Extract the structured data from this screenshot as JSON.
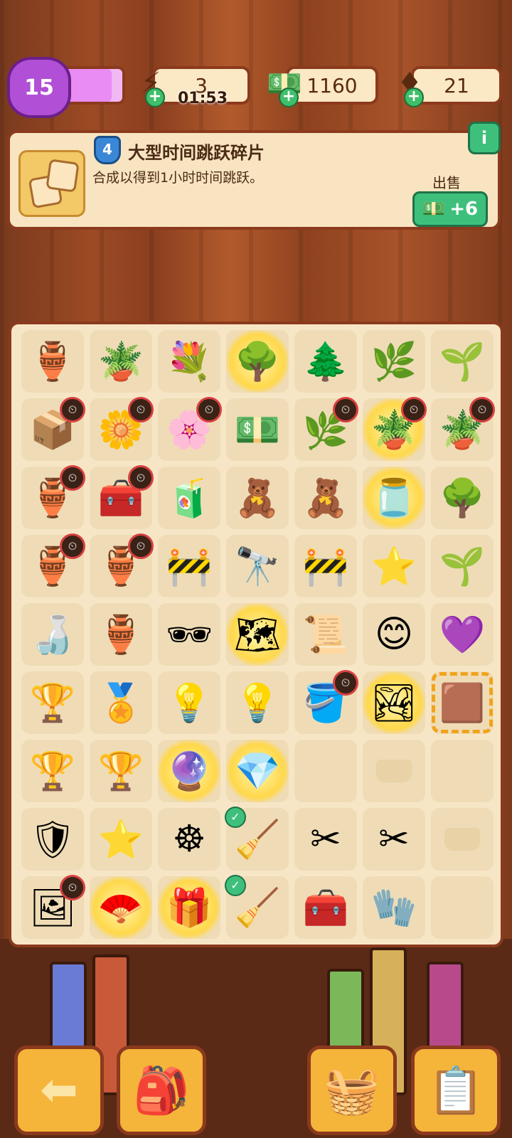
{
  "hud": {
    "level": "15",
    "level_progress": 0.85,
    "energy": "3",
    "energy_timer": "01:53",
    "cash": "1160",
    "gems": "21"
  },
  "info": {
    "item_level": "4",
    "title": "大型时间跳跃碎片",
    "description": "合成以得到1小时时间跳跃。",
    "sell_label": "出售",
    "sell_value": "+6",
    "info_button": "i"
  },
  "board": {
    "cells": [
      {
        "icon": "broken-pot",
        "glyph": "🏺"
      },
      {
        "icon": "clay-pot",
        "glyph": "🪴"
      },
      {
        "icon": "flower-basket",
        "glyph": "💐"
      },
      {
        "icon": "glowing-tree-orb",
        "glyph": "🌳",
        "glow": true
      },
      {
        "icon": "bonsai",
        "glyph": "🌲"
      },
      {
        "icon": "sprout-large",
        "glyph": "🌿"
      },
      {
        "icon": "sprout-small",
        "glyph": "🌱"
      },
      {
        "icon": "open-box",
        "glyph": "📦",
        "lock": true
      },
      {
        "icon": "flower-bed",
        "glyph": "🌼",
        "lock": true
      },
      {
        "icon": "flower-bed",
        "glyph": "🌸",
        "lock": true
      },
      {
        "icon": "cash-pile",
        "glyph": "💵"
      },
      {
        "icon": "planted-bush",
        "glyph": "🌿",
        "lock": true
      },
      {
        "icon": "glowing-flowerpot",
        "glyph": "🪴",
        "glow": true,
        "lock": true
      },
      {
        "icon": "herb-pot",
        "glyph": "🪴",
        "lock": true
      },
      {
        "icon": "ornate-vase",
        "glyph": "🏺",
        "lock": true
      },
      {
        "icon": "open-chest",
        "glyph": "🧰",
        "lock": true
      },
      {
        "icon": "juice-box",
        "glyph": "🧃"
      },
      {
        "icon": "teddy-bear-honey",
        "glyph": "🧸"
      },
      {
        "icon": "teddy-bear",
        "glyph": "🧸"
      },
      {
        "icon": "glowing-jar",
        "glyph": "🫙",
        "glow": true
      },
      {
        "icon": "potted-tree",
        "glyph": "🌳"
      },
      {
        "icon": "round-vase",
        "glyph": "🏺",
        "lock": true
      },
      {
        "icon": "striped-vase",
        "glyph": "🏺",
        "lock": true
      },
      {
        "icon": "barrier-small",
        "glyph": "🚧"
      },
      {
        "icon": "binoculars",
        "glyph": "🔭"
      },
      {
        "icon": "barrier",
        "glyph": "🚧"
      },
      {
        "icon": "purple-star",
        "glyph": "⭐"
      },
      {
        "icon": "seedling-pot",
        "glyph": "🌱"
      },
      {
        "icon": "glass-bottle",
        "glyph": "🍶"
      },
      {
        "icon": "tall-vase",
        "glyph": "🏺"
      },
      {
        "icon": "sunglasses",
        "glyph": "🕶"
      },
      {
        "icon": "glowing-map",
        "glyph": "🗺",
        "glow": true
      },
      {
        "icon": "seed-packet",
        "glyph": "📜"
      },
      {
        "icon": "purple-blob",
        "glyph": "😊"
      },
      {
        "icon": "purple-gem",
        "glyph": "💜"
      },
      {
        "icon": "star-trophy",
        "glyph": "🏆"
      },
      {
        "icon": "gold-statue",
        "glyph": "🏅"
      },
      {
        "icon": "lamp-post",
        "glyph": "💡"
      },
      {
        "icon": "bulb",
        "glyph": "💡"
      },
      {
        "icon": "cauldron",
        "glyph": "🪣",
        "lock": true
      },
      {
        "icon": "glowing-waterfall",
        "glyph": "🏞",
        "glow": true
      },
      {
        "icon": "time-shards",
        "glyph": "🟫",
        "selected": true
      },
      {
        "icon": "gold-figure",
        "glyph": "🏆"
      },
      {
        "icon": "star-award",
        "glyph": "🏆"
      },
      {
        "icon": "glowing-crystal",
        "glyph": "🔮",
        "glow": true
      },
      {
        "icon": "glowing-gem",
        "glyph": "💎",
        "glow": true
      },
      {
        "icon": "",
        "empty": true,
        "blank": true
      },
      {
        "icon": "",
        "empty": true
      },
      {
        "icon": "",
        "empty": true,
        "blank": true
      },
      {
        "icon": "shield-trophy",
        "glyph": "🛡"
      },
      {
        "icon": "crystal-star-trophy",
        "glyph": "⭐"
      },
      {
        "icon": "ship-wheel",
        "glyph": "☸"
      },
      {
        "icon": "rake",
        "glyph": "🧹",
        "check": true
      },
      {
        "icon": "pruning-shears",
        "glyph": "✂"
      },
      {
        "icon": "garden-shears",
        "glyph": "✂"
      },
      {
        "icon": "",
        "empty": true
      },
      {
        "icon": "family-portrait",
        "glyph": "🖼",
        "lock": true
      },
      {
        "icon": "glowing-fan",
        "glyph": "🪭",
        "glow": true
      },
      {
        "icon": "glowing-box",
        "glyph": "🎁",
        "glow": true
      },
      {
        "icon": "rake",
        "glyph": "🧹",
        "check": true
      },
      {
        "icon": "toolbox",
        "glyph": "🧰"
      },
      {
        "icon": "gloves",
        "glyph": "🧤"
      },
      {
        "icon": "",
        "empty": true,
        "blank": true
      }
    ]
  },
  "nav": {
    "back": "⬅",
    "backpack": "🎒",
    "shop": "🧺",
    "tasks": "📋"
  }
}
